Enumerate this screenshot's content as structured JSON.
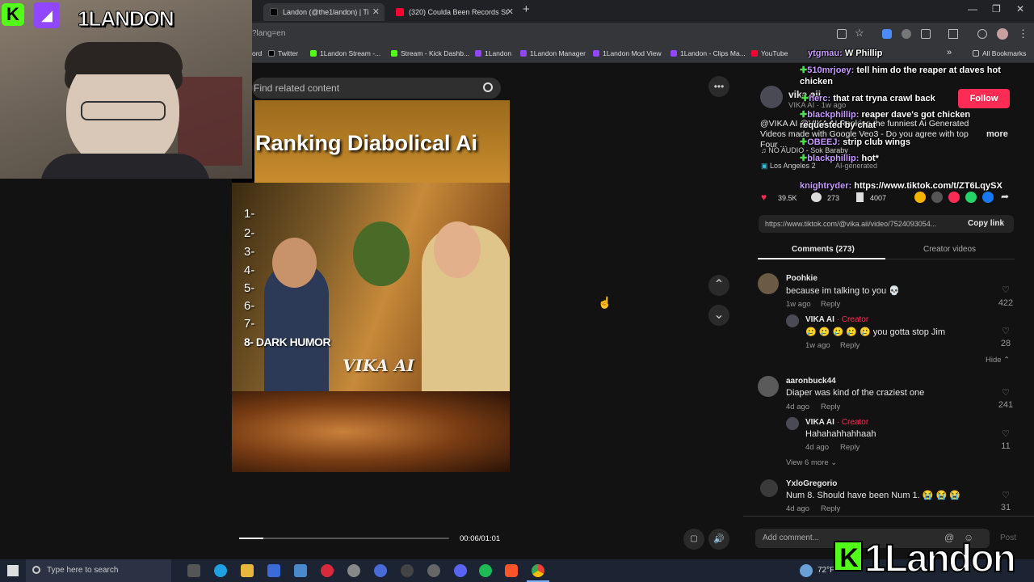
{
  "overlay": {
    "streamer_name": "1LANDON",
    "brand": "1Landon",
    "brand_k": "K"
  },
  "tabs": [
    {
      "title": "Landon (@the1landon) | Ti",
      "close": "✕"
    },
    {
      "title": "(320) Coulda Been Records St",
      "close": "✕"
    }
  ],
  "window": {
    "new_tab": "+",
    "minimize": "—",
    "restore": "❐",
    "close": "✕"
  },
  "address": {
    "url": "?lang=en"
  },
  "bookmarks": [
    "ord",
    "Twitter",
    "1Landon Stream -...",
    "Stream - Kick Dashb...",
    "1Landon",
    "1Landon Manager",
    "1Landon Mod View",
    "1Landon - Clips Ma...",
    "YouTube"
  ],
  "bookmarks_more": "»",
  "all_bookmarks": "All Bookmarks",
  "search": {
    "placeholder": "Find related content"
  },
  "video": {
    "title": "Ranking Diabolical Ai",
    "ranks": [
      "1-",
      "2-",
      "3-",
      "4-",
      "5-",
      "6-",
      "7-",
      "8- DARK HUMOR"
    ],
    "watermark": "VIKA AI",
    "time": "00:06/01:01",
    "progress": 0.114
  },
  "icons": {
    "more": "•••",
    "up": "⌃",
    "down": "⌄",
    "like": "♡",
    "volume": "🔊"
  },
  "creator": {
    "handle": "vika.aii",
    "sub": "VIKA AI · 1w ago",
    "follow": "Follow",
    "desc": "@VIKA AI @VIKA AI Ranking the funniest Ai Generated Videos made with Google Veo3 - Do you agree with top Four ...",
    "more": "more",
    "music": "♫ NO AUDIO - Sok Baraby",
    "location": "Los Angeles",
    "location_count": "2",
    "ai_generated": "AI-generated"
  },
  "stats": {
    "likes": "39.5K",
    "comments": "273",
    "saves": "4007"
  },
  "link": {
    "url": "https://www.tiktok.com/@vika.aii/video/7524093054...",
    "copy": "Copy link"
  },
  "panel_tabs": {
    "comments": "Comments (273)",
    "creator_videos": "Creator videos"
  },
  "comments": [
    {
      "name": "Poohkie",
      "text": "because im talking to you 💀",
      "time": "1w ago",
      "reply": "Reply",
      "likes": "422"
    },
    {
      "name": "VIKA AI",
      "badge": "· Creator",
      "text": "🥲 🥲 🥲 🥲 🥲  you gotta stop Jim",
      "time": "1w ago",
      "reply": "Reply",
      "likes": "28"
    },
    {
      "name": "aaronbuck44",
      "text": "Diaper was kind of the craziest one",
      "time": "4d ago",
      "reply": "Reply",
      "likes": "241"
    },
    {
      "name": "VIKA AI",
      "badge": "· Creator",
      "text": "Hahahahhahhaah",
      "time": "4d ago",
      "reply": "Reply",
      "likes": "11"
    },
    {
      "name": "YxloGregorio",
      "text": "Num 8. Should have been Num 1. 😭 😭 😭",
      "time": "4d ago",
      "reply": "Reply",
      "likes": "31"
    }
  ],
  "hide": "Hide ⌃",
  "view_more": "View 6 more ⌄",
  "add_comment": {
    "placeholder": "Add comment...",
    "post": "Post"
  },
  "chat": [
    {
      "user": "ytgmau:",
      "msg": "W Phillip"
    },
    {
      "user": "510mrjoey:",
      "msg": "tell him do the reaper at daves hot"
    },
    {
      "user": "",
      "msg": "chicken"
    },
    {
      "user": "herc:",
      "msg": "that rat tryna crawl back"
    },
    {
      "user": "blackphillip:",
      "msg": "reaper dave's got chicken"
    },
    {
      "user": "",
      "msg": "requested by chat"
    },
    {
      "user": "OBEEJ:",
      "msg": "strip club wings"
    },
    {
      "user": "blackphillip:",
      "msg": "hot*"
    },
    {
      "user": "knightryder:",
      "msg": "https://www.tiktok.com/t/ZT6LqySX"
    }
  ],
  "taskbar": {
    "search": "Type here to search",
    "weather": "72°F"
  }
}
